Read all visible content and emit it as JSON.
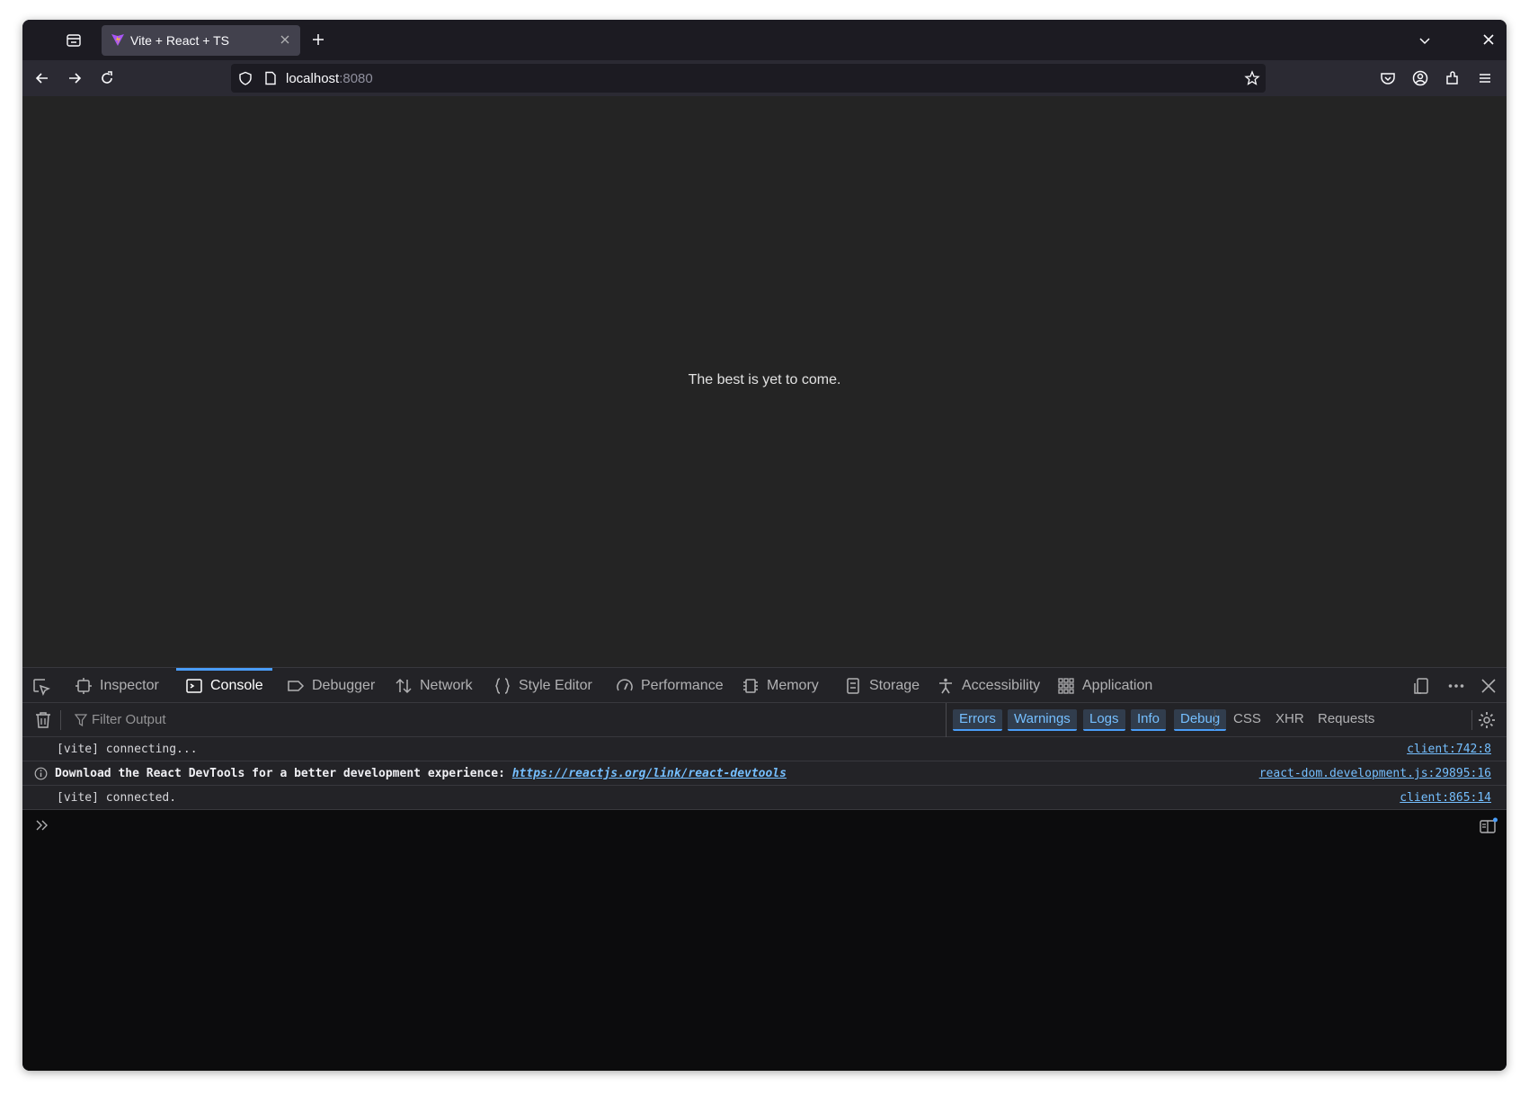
{
  "browser": {
    "tab_title": "Vite + React + TS",
    "url_host": "localhost",
    "url_port": ":8080"
  },
  "page": {
    "message": "The best is yet to come."
  },
  "devtools": {
    "tabs": [
      {
        "label": "Inspector",
        "icon": "inspector-icon"
      },
      {
        "label": "Console",
        "icon": "console-icon",
        "selected": true
      },
      {
        "label": "Debugger",
        "icon": "debugger-icon"
      },
      {
        "label": "Network",
        "icon": "network-icon"
      },
      {
        "label": "Style Editor",
        "icon": "style-editor-icon"
      },
      {
        "label": "Performance",
        "icon": "performance-icon"
      },
      {
        "label": "Memory",
        "icon": "memory-icon"
      },
      {
        "label": "Storage",
        "icon": "storage-icon"
      },
      {
        "label": "Accessibility",
        "icon": "accessibility-icon"
      },
      {
        "label": "Application",
        "icon": "application-icon"
      }
    ],
    "filter_placeholder": "Filter Output",
    "log_levels": [
      "Errors",
      "Warnings",
      "Logs",
      "Info",
      "Debug"
    ],
    "extra_filters": [
      "CSS",
      "XHR",
      "Requests"
    ],
    "messages": [
      {
        "text": "[vite] connecting...",
        "location": "client:742:8"
      },
      {
        "text": "Download the React DevTools for a better development experience: ",
        "link": "https://reactjs.org/link/react-devtools",
        "location": "react-dom.development.js:29895:16",
        "level": "info"
      },
      {
        "text": "[vite] connected.",
        "location": "client:865:14"
      }
    ]
  },
  "colors": {
    "accent": "#4a9df8",
    "link": "#75bfff",
    "page_bg": "#242424"
  }
}
